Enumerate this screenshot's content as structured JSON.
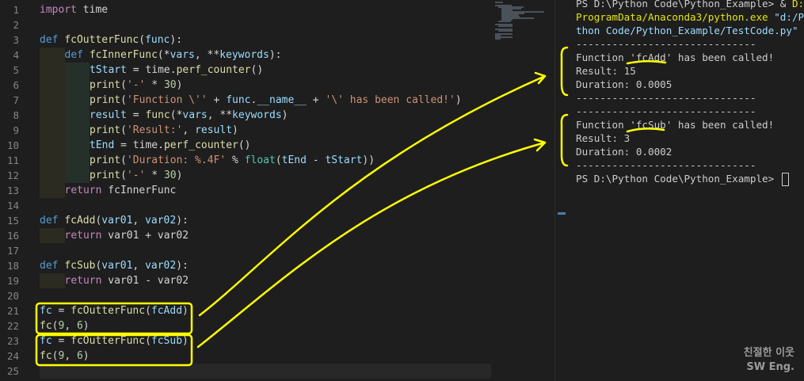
{
  "editor": {
    "line_numbers": [
      "1",
      "2",
      "3",
      "4",
      "5",
      "6",
      "7",
      "8",
      "9",
      "10",
      "11",
      "12",
      "13",
      "14",
      "15",
      "16",
      "17",
      "18",
      "19",
      "20",
      "21",
      "22",
      "23",
      "24",
      "25"
    ],
    "lines": [
      [
        {
          "t": "import",
          "c": "ctl"
        },
        {
          "t": " time",
          "c": "op"
        }
      ],
      [],
      [
        {
          "t": "def",
          "c": "kw"
        },
        {
          "t": " ",
          "c": "op"
        },
        {
          "t": "fcOutterFunc",
          "c": "fn"
        },
        {
          "t": "(",
          "c": "op"
        },
        {
          "t": "func",
          "c": "pr"
        },
        {
          "t": "):",
          "c": "op"
        }
      ],
      [
        {
          "t": "def",
          "c": "kw"
        },
        {
          "t": " ",
          "c": "op"
        },
        {
          "t": "fcInnerFunc",
          "c": "fn"
        },
        {
          "t": "(*",
          "c": "op"
        },
        {
          "t": "vars",
          "c": "pr"
        },
        {
          "t": ", **",
          "c": "op"
        },
        {
          "t": "keywords",
          "c": "pr"
        },
        {
          "t": "):",
          "c": "op"
        }
      ],
      [
        {
          "t": "tStart",
          "c": "pr"
        },
        {
          "t": " = time.",
          "c": "op"
        },
        {
          "t": "perf_counter",
          "c": "fn"
        },
        {
          "t": "()",
          "c": "op"
        }
      ],
      [
        {
          "t": "print",
          "c": "fn"
        },
        {
          "t": "(",
          "c": "op"
        },
        {
          "t": "'-'",
          "c": "st"
        },
        {
          "t": " * ",
          "c": "op"
        },
        {
          "t": "30",
          "c": "nm"
        },
        {
          "t": ")",
          "c": "op"
        }
      ],
      [
        {
          "t": "print",
          "c": "fn"
        },
        {
          "t": "(",
          "c": "op"
        },
        {
          "t": "'Function \\'' ",
          "c": "st"
        },
        {
          "t": "+ ",
          "c": "op"
        },
        {
          "t": "func",
          "c": "pr"
        },
        {
          "t": ".",
          "c": "op"
        },
        {
          "t": "__name__",
          "c": "pr"
        },
        {
          "t": " + ",
          "c": "op"
        },
        {
          "t": "'\\' has been called!'",
          "c": "st"
        },
        {
          "t": ")",
          "c": "op"
        }
      ],
      [
        {
          "t": "result",
          "c": "pr"
        },
        {
          "t": " = ",
          "c": "op"
        },
        {
          "t": "func",
          "c": "fn"
        },
        {
          "t": "(*",
          "c": "op"
        },
        {
          "t": "vars",
          "c": "pr"
        },
        {
          "t": ", **",
          "c": "op"
        },
        {
          "t": "keywords",
          "c": "pr"
        },
        {
          "t": ")",
          "c": "op"
        }
      ],
      [
        {
          "t": "print",
          "c": "fn"
        },
        {
          "t": "(",
          "c": "op"
        },
        {
          "t": "'Result:'",
          "c": "st"
        },
        {
          "t": ", ",
          "c": "op"
        },
        {
          "t": "result",
          "c": "pr"
        },
        {
          "t": ")",
          "c": "op"
        }
      ],
      [
        {
          "t": "tEnd",
          "c": "pr"
        },
        {
          "t": " = time.",
          "c": "op"
        },
        {
          "t": "perf_counter",
          "c": "fn"
        },
        {
          "t": "()",
          "c": "op"
        }
      ],
      [
        {
          "t": "print",
          "c": "fn"
        },
        {
          "t": "(",
          "c": "op"
        },
        {
          "t": "'Duration: %.4F'",
          "c": "st"
        },
        {
          "t": " % ",
          "c": "op"
        },
        {
          "t": "float",
          "c": "bu"
        },
        {
          "t": "(",
          "c": "op"
        },
        {
          "t": "tEnd",
          "c": "pr"
        },
        {
          "t": " - ",
          "c": "op"
        },
        {
          "t": "tStart",
          "c": "pr"
        },
        {
          "t": "))",
          "c": "op"
        }
      ],
      [
        {
          "t": "print",
          "c": "fn"
        },
        {
          "t": "(",
          "c": "op"
        },
        {
          "t": "'-'",
          "c": "st"
        },
        {
          "t": " * ",
          "c": "op"
        },
        {
          "t": "30",
          "c": "nm"
        },
        {
          "t": ")",
          "c": "op"
        }
      ],
      [
        {
          "t": "return",
          "c": "ctl"
        },
        {
          "t": " fcInnerFunc",
          "c": "op"
        }
      ],
      [],
      [
        {
          "t": "def",
          "c": "kw"
        },
        {
          "t": " ",
          "c": "op"
        },
        {
          "t": "fcAdd",
          "c": "fn"
        },
        {
          "t": "(",
          "c": "op"
        },
        {
          "t": "var01",
          "c": "pr"
        },
        {
          "t": ", ",
          "c": "op"
        },
        {
          "t": "var02",
          "c": "pr"
        },
        {
          "t": "):",
          "c": "op"
        }
      ],
      [
        {
          "t": "return",
          "c": "ctl"
        },
        {
          "t": " var01 + var02",
          "c": "op"
        }
      ],
      [],
      [
        {
          "t": "def",
          "c": "kw"
        },
        {
          "t": " ",
          "c": "op"
        },
        {
          "t": "fcSub",
          "c": "fn"
        },
        {
          "t": "(",
          "c": "op"
        },
        {
          "t": "var01",
          "c": "pr"
        },
        {
          "t": ", ",
          "c": "op"
        },
        {
          "t": "var02",
          "c": "pr"
        },
        {
          "t": "):",
          "c": "op"
        }
      ],
      [
        {
          "t": "return",
          "c": "ctl"
        },
        {
          "t": " var01 - var02",
          "c": "op"
        }
      ],
      [],
      [
        {
          "t": "fc",
          "c": "pr"
        },
        {
          "t": " = ",
          "c": "op"
        },
        {
          "t": "fcOutterFunc",
          "c": "fn"
        },
        {
          "t": "(",
          "c": "op"
        },
        {
          "t": "fcAdd",
          "c": "pr"
        },
        {
          "t": ")",
          "c": "op"
        }
      ],
      [
        {
          "t": "fc",
          "c": "fn"
        },
        {
          "t": "(",
          "c": "op"
        },
        {
          "t": "9",
          "c": "nm"
        },
        {
          "t": ", ",
          "c": "op"
        },
        {
          "t": "6",
          "c": "nm"
        },
        {
          "t": ")",
          "c": "op"
        }
      ],
      [
        {
          "t": "fc",
          "c": "pr"
        },
        {
          "t": " = ",
          "c": "op"
        },
        {
          "t": "fcOutterFunc",
          "c": "fn"
        },
        {
          "t": "(",
          "c": "op"
        },
        {
          "t": "fcSub",
          "c": "pr"
        },
        {
          "t": ")",
          "c": "op"
        }
      ],
      [
        {
          "t": "fc",
          "c": "fn"
        },
        {
          "t": "(",
          "c": "op"
        },
        {
          "t": "9",
          "c": "nm"
        },
        {
          "t": ", ",
          "c": "op"
        },
        {
          "t": "6",
          "c": "nm"
        },
        {
          "t": ")",
          "c": "op"
        }
      ],
      []
    ]
  },
  "terminal": {
    "prompt_line_1a": "PS D:\\Python Code\\Python_Example> & ",
    "prompt_line_1b": "D:/",
    "prompt_line_2a": "ProgramData/Anaconda3/python.exe",
    "prompt_line_2b": " \"d:/Py",
    "prompt_line_3": "thon Code/Python_Example/TestCode.py\"",
    "separator": "------------------------------",
    "add_called": "Function 'fcAdd' has been called!",
    "add_result": "Result: 15",
    "add_duration": "Duration: 0.0005",
    "sub_called": "Function 'fcSub' has been called!",
    "sub_result": "Result: 3",
    "sub_duration": "Duration: 0.0002",
    "final_prompt": "PS D:\\Python Code\\Python_Example> "
  },
  "watermark": {
    "line1": "친절한 이웃",
    "line2": "SW Eng."
  },
  "colors": {
    "background": "#1e1e1e",
    "annotation": "#ffff00",
    "terminal_path": "#e5e510"
  }
}
